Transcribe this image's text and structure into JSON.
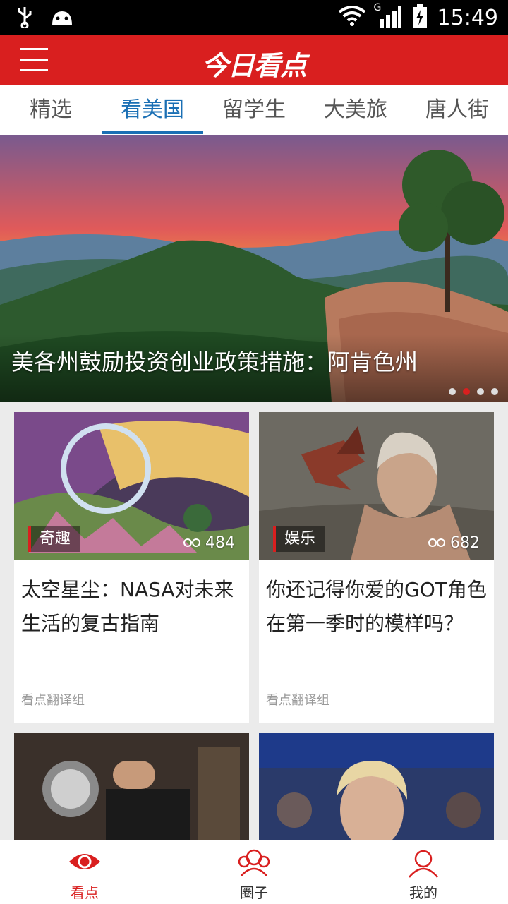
{
  "status": {
    "time": "15:49",
    "network_type": "G"
  },
  "app": {
    "logo": "今日看点"
  },
  "tabs": [
    {
      "label": "精选"
    },
    {
      "label": "看美国",
      "active": true
    },
    {
      "label": "留学生"
    },
    {
      "label": "大美旅"
    },
    {
      "label": "唐人街"
    }
  ],
  "hero": {
    "title": "美各州鼓励投资创业政策措施：阿肯色州",
    "dots_count": 4,
    "active_dot": 1
  },
  "cards": [
    {
      "tag": "奇趣",
      "views": "484",
      "title": "太空星尘：NASA对未来生活的复古指南",
      "source": "看点翻译组"
    },
    {
      "tag": "娱乐",
      "views": "682",
      "title": "你还记得你爱的GOT角色在第一季时的模样吗？",
      "source": "看点翻译组"
    }
  ],
  "bottom_nav": [
    {
      "label": "看点",
      "icon": "eye-icon",
      "active": true
    },
    {
      "label": "圈子",
      "icon": "group-icon"
    },
    {
      "label": "我的",
      "icon": "profile-icon"
    }
  ],
  "colors": {
    "brand": "#d91f1f",
    "tab_active": "#1a6fb4"
  }
}
